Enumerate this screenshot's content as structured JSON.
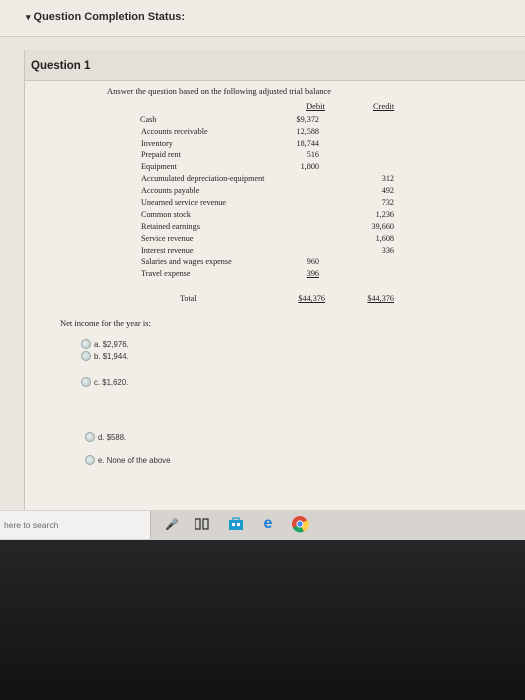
{
  "status": {
    "label": "Question Completion Status:"
  },
  "question": {
    "title": "Question 1",
    "prompt": "Answer the question based on the following adjusted trial balance",
    "headers": {
      "debit": "Debit",
      "credit": "Credit"
    },
    "rows": [
      {
        "label": "Cash",
        "debit": "$9,372",
        "credit": ""
      },
      {
        "label": "Accounts receivable",
        "debit": "12,588",
        "credit": ""
      },
      {
        "label": "Inventory",
        "debit": "18,744",
        "credit": ""
      },
      {
        "label": "Prepaid rent",
        "debit": "516",
        "credit": ""
      },
      {
        "label": "Equipment",
        "debit": "1,800",
        "credit": ""
      },
      {
        "label": "Accumulated depreciation-equipment",
        "debit": "",
        "credit": "312"
      },
      {
        "label": "Accounts payable",
        "debit": "",
        "credit": "492"
      },
      {
        "label": "Unearned service revenue",
        "debit": "",
        "credit": "732"
      },
      {
        "label": "Common stock",
        "debit": "",
        "credit": "1,236"
      },
      {
        "label": "Retained earnings",
        "debit": "",
        "credit": "39,660"
      },
      {
        "label": "Service revenue",
        "debit": "",
        "credit": "1,608"
      },
      {
        "label": "Interest revenue",
        "debit": "",
        "credit": "336"
      },
      {
        "label": "Salaries and wages expense",
        "debit": "960",
        "credit": ""
      },
      {
        "label": "Travel expense",
        "debit": "396",
        "credit": ""
      }
    ],
    "total": {
      "label": "Total",
      "debit": "$44,376",
      "credit": "$44,376"
    },
    "question_text": "Net income for the year is:",
    "options": [
      {
        "letter": "a.",
        "text": "$2,976."
      },
      {
        "letter": "b.",
        "text": "$1,944."
      },
      {
        "letter": "c.",
        "text": "$1,620."
      },
      {
        "letter": "d.",
        "text": "$588."
      },
      {
        "letter": "e.",
        "text": "None of the above"
      }
    ]
  },
  "taskbar": {
    "search_placeholder": "here to search",
    "icons": [
      "microphone-icon",
      "task-view-icon",
      "store-icon",
      "edge-icon",
      "chrome-icon"
    ]
  }
}
